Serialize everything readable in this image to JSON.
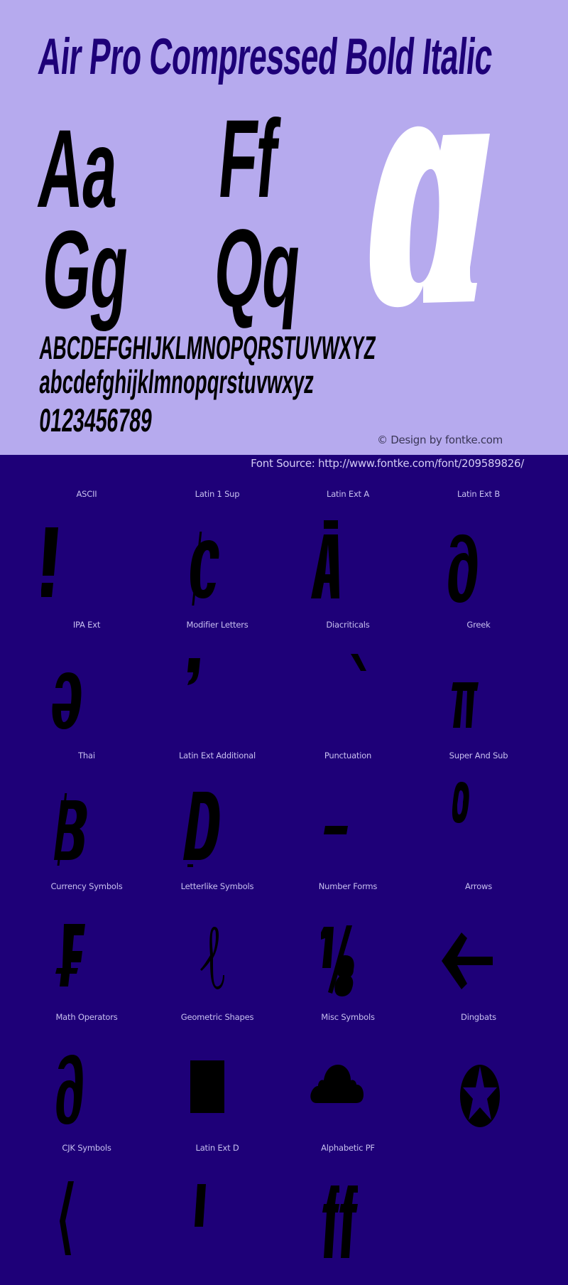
{
  "font_name": "Air Pro Compressed Bold Italic",
  "colors": {
    "hero_background": "#b6aaee",
    "page_background": "#1e0078",
    "title_color": "#1e0078",
    "glyph_color": "#000000",
    "highlight_glyph_color": "#ffffff",
    "label_color": "#c8c0f0"
  },
  "hero": {
    "pairs": [
      "Aa",
      "Ff",
      "Gg",
      "Qq"
    ],
    "highlight_glyph": "a",
    "uppercase": "ABCDEFGHIJKLMNOPQRSTUVWXYZ",
    "lowercase": "abcdefghijklmnopqrstuvwxyz",
    "digits": "0123456789",
    "credit": "© Design by fontke.com"
  },
  "source": "Font Source: http://www.fontke.com/font/209589826/",
  "blocks": [
    {
      "label": "ASCII",
      "glyph": "!",
      "icon": "exclamation-glyph"
    },
    {
      "label": "Latin 1 Sup",
      "glyph": "¢",
      "icon": "cent-glyph"
    },
    {
      "label": "Latin Ext A",
      "glyph": "Ā",
      "icon": "a-macron-glyph"
    },
    {
      "label": "Latin Ext B",
      "glyph": "ȡ",
      "icon": "partial-glyph"
    },
    {
      "label": "IPA Ext",
      "glyph": "ə",
      "icon": "schwa-glyph"
    },
    {
      "label": "Modifier Letters",
      "glyph": "ʼ",
      "icon": "apostrophe-glyph"
    },
    {
      "label": "Diacriticals",
      "glyph": "̀",
      "icon": "grave-accent-glyph"
    },
    {
      "label": "Greek",
      "glyph": "π",
      "icon": "pi-glyph"
    },
    {
      "label": "Thai",
      "glyph": "฿",
      "icon": "baht-glyph"
    },
    {
      "label": "Latin Ext Additional",
      "glyph": "Ḍ",
      "icon": "d-dot-below-glyph"
    },
    {
      "label": "Punctuation",
      "glyph": "–",
      "icon": "en-dash-glyph"
    },
    {
      "label": "Super And Sub",
      "glyph": "⁰",
      "icon": "superscript-zero-glyph"
    },
    {
      "label": "Currency Symbols",
      "glyph": "₣",
      "icon": "franc-glyph"
    },
    {
      "label": "Letterlike Symbols",
      "glyph": "ℓ",
      "icon": "script-l-glyph"
    },
    {
      "label": "Number Forms",
      "glyph": "⅛",
      "icon": "one-eighth-glyph"
    },
    {
      "label": "Arrows",
      "glyph": "←",
      "icon": "left-arrow-glyph"
    },
    {
      "label": "Math Operators",
      "glyph": "∂",
      "icon": "partial-differential-glyph"
    },
    {
      "label": "Geometric Shapes",
      "glyph": "■",
      "icon": "black-square-glyph"
    },
    {
      "label": "Misc Symbols",
      "glyph": "☁",
      "icon": "cloud-glyph"
    },
    {
      "label": "Dingbats",
      "glyph": "✪",
      "icon": "circled-star-glyph"
    },
    {
      "label": "CJK Symbols",
      "glyph": "〈",
      "icon": "angle-bracket-glyph"
    },
    {
      "label": "Latin Ext D",
      "glyph": "ꞌ",
      "icon": "saltillo-glyph"
    },
    {
      "label": "Alphabetic PF",
      "glyph": "ﬀ",
      "icon": "ff-ligature-glyph"
    }
  ]
}
